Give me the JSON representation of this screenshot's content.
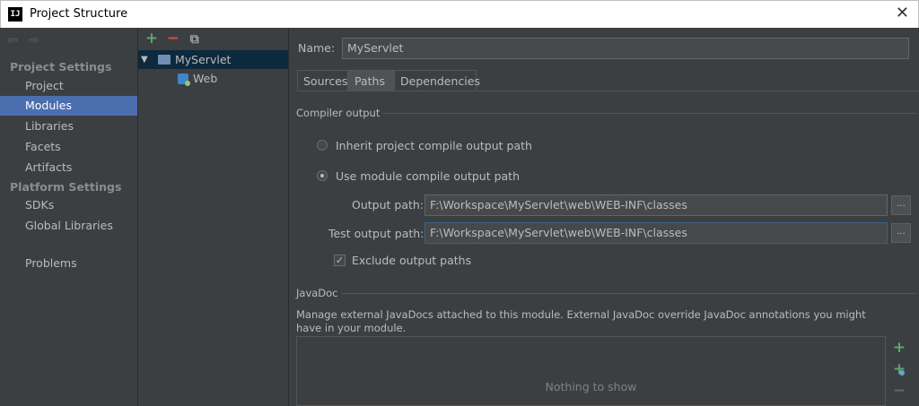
{
  "window": {
    "icon_text": "IJ",
    "title": "Project Structure",
    "close_glyph": "✕"
  },
  "sidebar": {
    "back_glyph": "⇦",
    "forward_glyph": "⇨",
    "section_project": "Project Settings",
    "items_project": [
      "Project",
      "Modules",
      "Libraries",
      "Facets",
      "Artifacts"
    ],
    "section_platform": "Platform Settings",
    "items_platform": [
      "SDKs",
      "Global Libraries"
    ],
    "problems": "Problems"
  },
  "tree": {
    "add_glyph": "+",
    "remove_glyph": "−",
    "copy_glyph": "⧉",
    "root": "MyServlet",
    "root_caret": "▼",
    "child": "Web"
  },
  "module": {
    "name_label": "Name:",
    "name_value": "MyServlet",
    "tabs": [
      "Sources",
      "Paths",
      "Dependencies"
    ],
    "compiler_output_title": "Compiler output",
    "radio_inherit": "Inherit project compile output path",
    "radio_module": "Use module compile output path",
    "output_path_label": "Output path:",
    "output_path_value": "F:\\Workspace\\MyServlet\\web\\WEB-INF\\classes",
    "test_output_path_label": "Test output path:",
    "test_output_path_value": "F:\\Workspace\\MyServlet\\web\\WEB-INF\\classes",
    "browse_glyph": "...",
    "exclude_label": "Exclude output paths",
    "exclude_checked": "✓",
    "javadoc_title": "JavaDoc",
    "javadoc_desc": "Manage external JavaDocs attached to this module. External JavaDoc override JavaDoc annotations you might have in your module.",
    "javadoc_empty": "Nothing to show",
    "add_glyph": "+",
    "add_url_glyph": "+",
    "remove_glyph": "−"
  },
  "colors": {
    "selection": "#4b6eaf",
    "tree_selection": "#0d293e",
    "add_green": "#59a869",
    "remove_red": "#c75450",
    "background": "#3c3f41"
  }
}
